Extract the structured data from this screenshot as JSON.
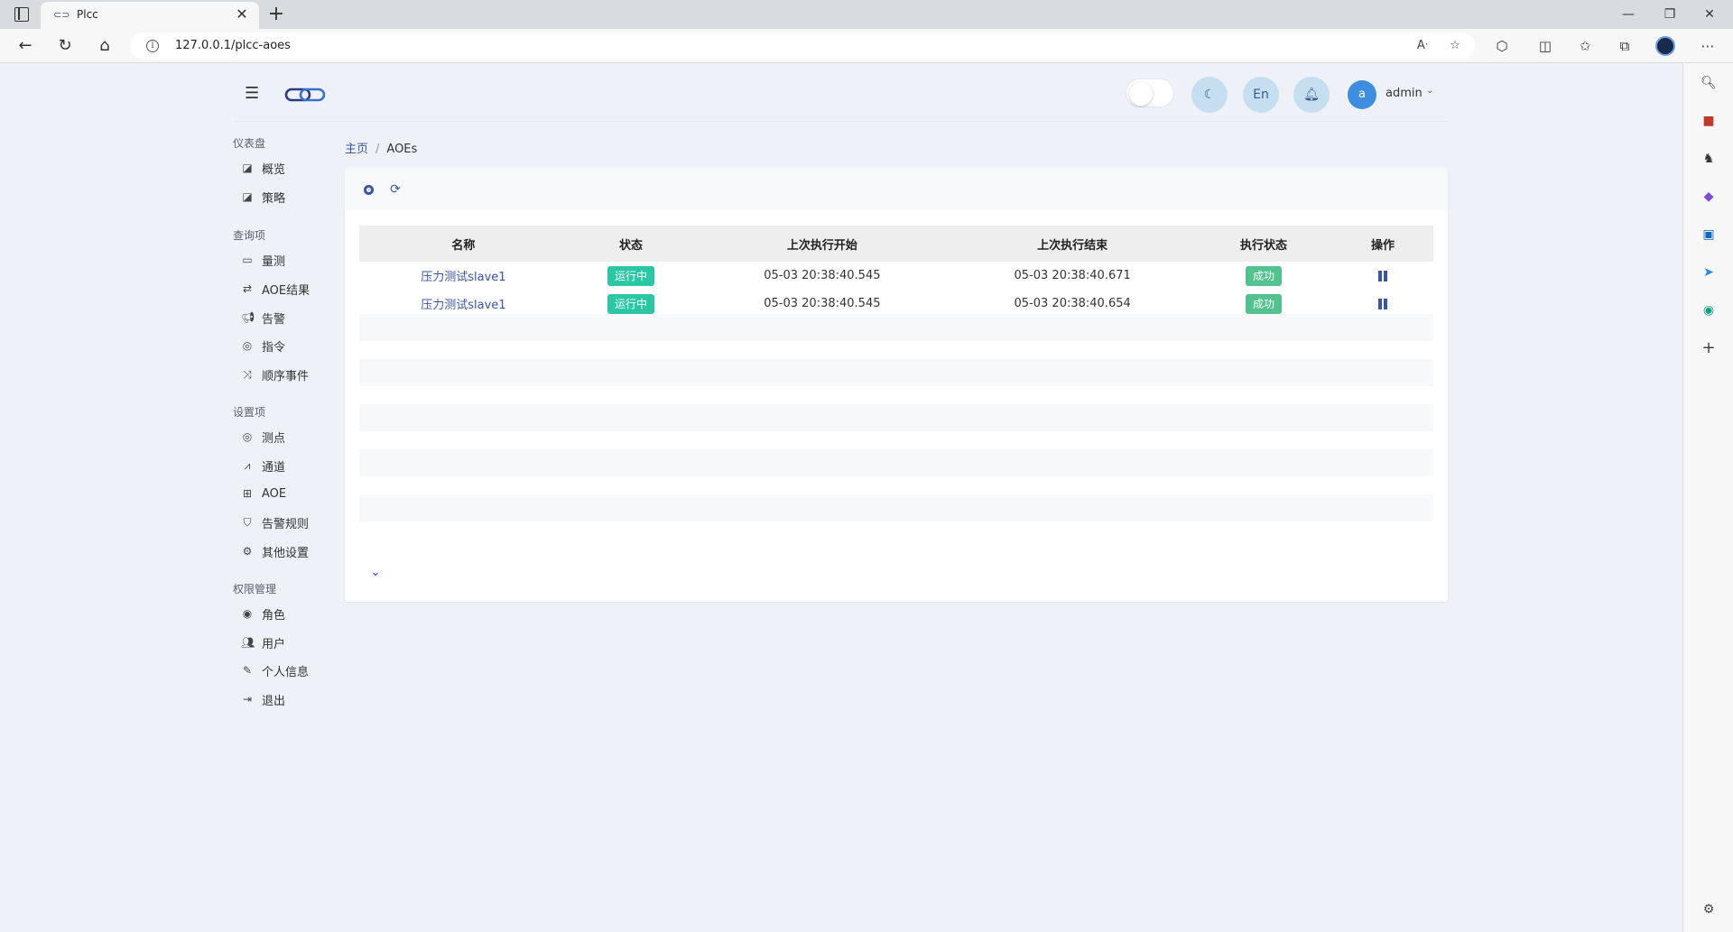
{
  "browser": {
    "tab_title": "Plcc",
    "url": "127.0.0.1/plcc-aoes"
  },
  "header": {
    "lang_button": "En",
    "user_initial": "a",
    "username": "admin"
  },
  "sidebar": {
    "groups": [
      {
        "label": "仪表盘",
        "items": [
          "概览",
          "策略"
        ]
      },
      {
        "label": "查询项",
        "items": [
          "量测",
          "AOE结果",
          "告警",
          "指令",
          "顺序事件"
        ]
      },
      {
        "label": "设置项",
        "items": [
          "测点",
          "通道",
          "AOE",
          "告警规则",
          "其他设置"
        ]
      },
      {
        "label": "权限管理",
        "items": [
          "角色",
          "用户",
          "个人信息",
          "退出"
        ]
      }
    ]
  },
  "breadcrumb": {
    "home": "主页",
    "separator": "/",
    "current": "AOEs"
  },
  "table": {
    "columns": [
      "名称",
      "状态",
      "上次执行开始",
      "上次执行结束",
      "执行状态",
      "操作"
    ],
    "rows": [
      {
        "name": "压力测试slave1",
        "status": "运行中",
        "start": "05-03 20:38:40.545",
        "end": "05-03 20:38:40.671",
        "exec_status": "成功"
      },
      {
        "name": "压力测试slave1",
        "status": "运行中",
        "start": "05-03 20:38:40.545",
        "end": "05-03 20:38:40.654",
        "exec_status": "成功"
      }
    ]
  },
  "colors": {
    "accent": "#3a55a5",
    "running_badge": "#2bc7a4",
    "success_badge": "#52c38f",
    "app_background": "#eef2f8"
  }
}
